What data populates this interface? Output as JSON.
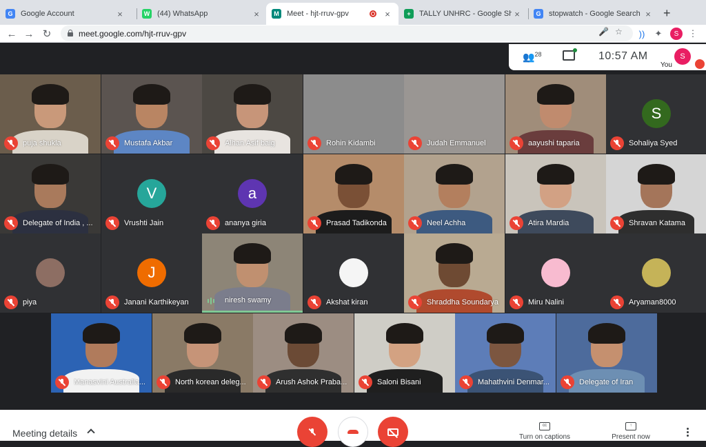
{
  "browser": {
    "tabs": [
      {
        "title": "Google Account",
        "favicon": "G",
        "favicon_color": "#4285f4"
      },
      {
        "title": "(44) WhatsApp",
        "favicon": "W",
        "favicon_color": "#25d366"
      },
      {
        "title": "Meet - hjt-rruv-gpv",
        "favicon": "M",
        "favicon_color": "#00897b",
        "active": true,
        "recording": true
      },
      {
        "title": "TALLY UNHRC - Google Sheets",
        "favicon": "+",
        "favicon_color": "#0f9d58"
      },
      {
        "title": "stopwatch - Google Search",
        "favicon": "G",
        "favicon_color": "#4285f4"
      }
    ],
    "url": "meet.google.com/hjt-rruv-gpv",
    "profile_initial": "S"
  },
  "meet": {
    "participant_count": "28",
    "clock": "10:57  AM",
    "you_label": "You",
    "you_initial": "S",
    "participants": [
      {
        "name": "puja shukla",
        "type": "video",
        "skin": "#c9997a",
        "shirt": "#d9d3c8",
        "bg": "#6b5d4c"
      },
      {
        "name": "Mustafa Akbar",
        "type": "video",
        "skin": "#b98563",
        "shirt": "#5d86c4",
        "bg": "#5b5450"
      },
      {
        "name": "Alhan Asif baig",
        "type": "video",
        "skin": "#c79579",
        "shirt": "#e8e4e0",
        "bg": "#4c4843"
      },
      {
        "name": "Rohin Kidambi",
        "type": "blank",
        "bg": "#8c8c8c"
      },
      {
        "name": "Judah Emmanuel",
        "type": "blank",
        "bg": "#9a9693"
      },
      {
        "name": "aayushi taparia",
        "type": "video",
        "skin": "#c08b6e",
        "shirt": "#6a3d3d",
        "bg": "#a08d7a"
      },
      {
        "name": "Sohaliya Syed",
        "type": "avatar",
        "initial": "S",
        "color": "#33691e"
      },
      {
        "name": "Delegate of India , ...",
        "type": "video",
        "skin": "#a97a5c",
        "shirt": "#2c3040",
        "bg": "#3a3937"
      },
      {
        "name": "Vrushti Jain",
        "type": "avatar",
        "initial": "V",
        "color": "#26a69a"
      },
      {
        "name": "ananya giria",
        "type": "avatar",
        "initial": "a",
        "color": "#5e35b1"
      },
      {
        "name": "Prasad Tadikonda",
        "type": "video",
        "skin": "#7a5036",
        "shirt": "#1c1c1c",
        "bg": "#b58c6a"
      },
      {
        "name": "Neel Achha",
        "type": "video",
        "skin": "#b37f5e",
        "shirt": "#3d5a80",
        "bg": "#b2a28e"
      },
      {
        "name": "Atira Mardia",
        "type": "video",
        "skin": "#d2a184",
        "shirt": "#3e4a5c",
        "bg": "#c9c4bb"
      },
      {
        "name": "Shravan Katama",
        "type": "video",
        "skin": "#a4755a",
        "shirt": "#2e2e2e",
        "bg": "#d5d5d5"
      },
      {
        "name": "piya",
        "type": "photo-avatar",
        "color": "#8d6e63"
      },
      {
        "name": "Janani Karthikeyan",
        "type": "avatar",
        "initial": "J",
        "color": "#ef6c00"
      },
      {
        "name": "niresh swamy",
        "type": "video",
        "skin": "#c09070",
        "shirt": "#7b7d8c",
        "bg": "#8d8577",
        "speaking": true
      },
      {
        "name": "Akshat kiran",
        "type": "photo-avatar",
        "color": "#f5f5f5"
      },
      {
        "name": "Shraddha Soundarya",
        "type": "video",
        "skin": "#6e4a33",
        "shirt": "#b04a2e",
        "bg": "#b9aa92"
      },
      {
        "name": "Miru Nalini",
        "type": "photo-avatar",
        "color": "#f8bbd0"
      },
      {
        "name": "Aryaman8000",
        "type": "photo-avatar",
        "color": "#c5b358"
      },
      {
        "name": "Manasvini Australia...",
        "type": "video",
        "skin": "#b07b5c",
        "shirt": "#f2f2f2",
        "bg": "#2c63b4"
      },
      {
        "name": "North korean deleg...",
        "type": "video",
        "skin": "#c69478",
        "shirt": "#2a2a2a",
        "bg": "#8a7a66"
      },
      {
        "name": "Arush Ashok Praba...",
        "type": "video",
        "skin": "#6b4a35",
        "shirt": "#2f2f2f",
        "bg": "#9c8d82"
      },
      {
        "name": "Saloni Bisani",
        "type": "video",
        "skin": "#d3a282",
        "shirt": "#1f1f1f",
        "bg": "#cfcdc6"
      },
      {
        "name": "Mahathvini Denmar...",
        "type": "video",
        "skin": "#7c5640",
        "shirt": "#3b5375",
        "bg": "#5d7db8"
      },
      {
        "name": "Delegate of Iran",
        "type": "video",
        "skin": "#c5906f",
        "shirt": "#6d8fb3",
        "bg": "#4d6b9c"
      }
    ]
  },
  "bottom": {
    "meeting_details": "Meeting details",
    "captions_label": "Turn on captions",
    "present_label": "Present now"
  }
}
